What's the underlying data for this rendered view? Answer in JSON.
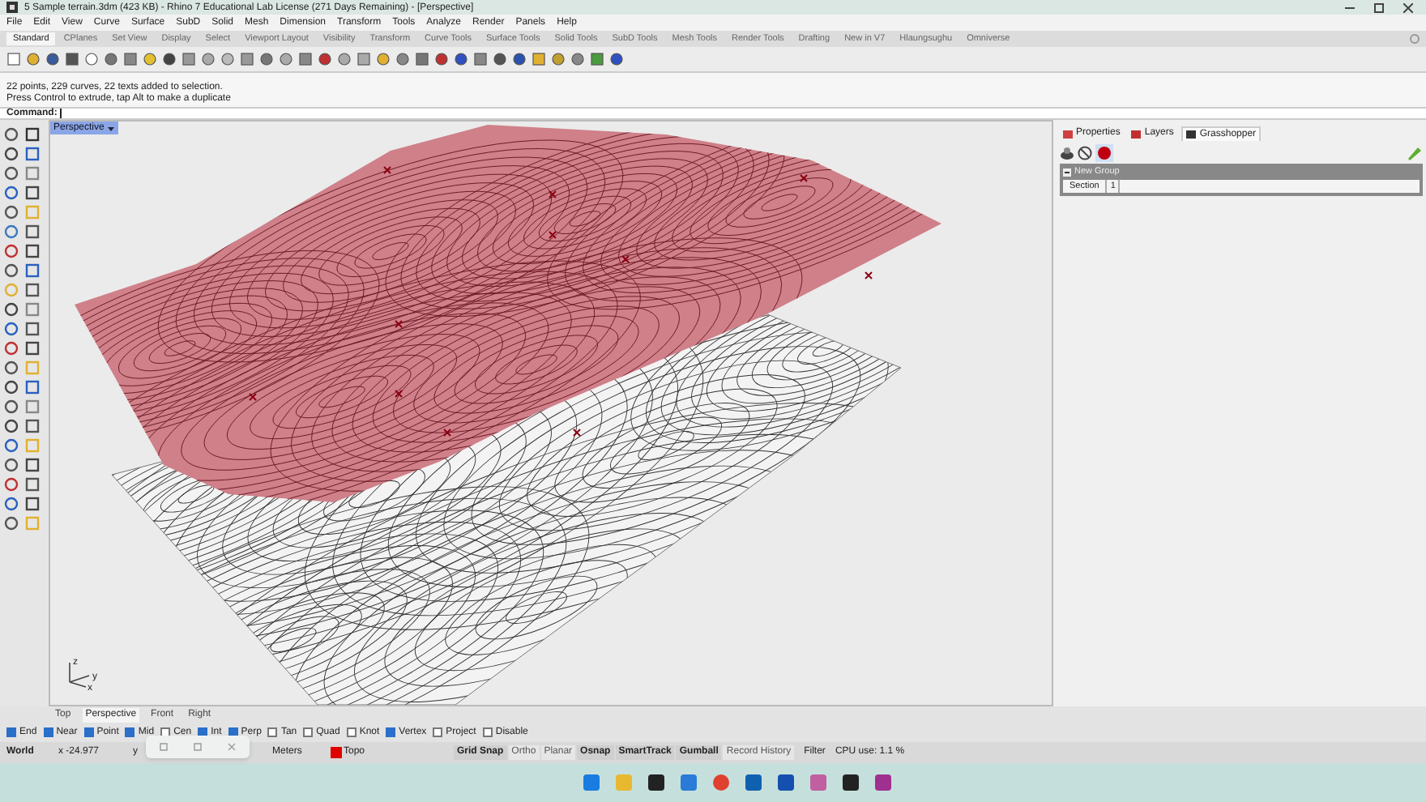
{
  "window": {
    "title": "5 Sample terrain.3dm (423 KB) - Rhino 7 Educational Lab License (271 Days Remaining) - [Perspective]"
  },
  "menu": [
    "File",
    "Edit",
    "View",
    "Curve",
    "Surface",
    "SubD",
    "Solid",
    "Mesh",
    "Dimension",
    "Transform",
    "Tools",
    "Analyze",
    "Render",
    "Panels",
    "Help"
  ],
  "toolbar_tabs": [
    {
      "label": "Standard",
      "selected": true
    },
    {
      "label": "CPlanes",
      "selected": false
    },
    {
      "label": "Set View",
      "selected": false
    },
    {
      "label": "Display",
      "selected": false
    },
    {
      "label": "Select",
      "selected": false
    },
    {
      "label": "Viewport Layout",
      "selected": false
    },
    {
      "label": "Visibility",
      "selected": false
    },
    {
      "label": "Transform",
      "selected": false
    },
    {
      "label": "Curve Tools",
      "selected": false
    },
    {
      "label": "Surface Tools",
      "selected": false
    },
    {
      "label": "Solid Tools",
      "selected": false
    },
    {
      "label": "SubD Tools",
      "selected": false
    },
    {
      "label": "Mesh Tools",
      "selected": false
    },
    {
      "label": "Render Tools",
      "selected": false
    },
    {
      "label": "Drafting",
      "selected": false
    },
    {
      "label": "New in V7",
      "selected": false
    },
    {
      "label": "Hlaungsughu",
      "selected": false
    },
    {
      "label": "Omniverse",
      "selected": false
    }
  ],
  "command_history": [
    "22 points, 229 curves, 22 texts added to selection.",
    "Press Control to extrude, tap Alt to make a duplicate"
  ],
  "command_prompt": "Command:",
  "viewport": {
    "label": "Perspective",
    "axes": [
      "z",
      "y",
      "x"
    ]
  },
  "panel": {
    "tabs": [
      {
        "label": "Properties",
        "selected": false
      },
      {
        "label": "Layers",
        "selected": false
      },
      {
        "label": "Grasshopper",
        "selected": true
      }
    ],
    "group": "New Group",
    "field_label": "Section",
    "field_value": "1"
  },
  "viewport_tabs": [
    {
      "label": "Top",
      "selected": false
    },
    {
      "label": "Perspective",
      "selected": true
    },
    {
      "label": "Front",
      "selected": false
    },
    {
      "label": "Right",
      "selected": false
    }
  ],
  "osnaps": [
    {
      "label": "End",
      "checked": true
    },
    {
      "label": "Near",
      "checked": true
    },
    {
      "label": "Point",
      "checked": true
    },
    {
      "label": "Mid",
      "checked": true
    },
    {
      "label": "Cen",
      "checked": false
    },
    {
      "label": "Int",
      "checked": true
    },
    {
      "label": "Perp",
      "checked": true
    },
    {
      "label": "Tan",
      "checked": false
    },
    {
      "label": "Quad",
      "checked": false
    },
    {
      "label": "Knot",
      "checked": false
    },
    {
      "label": "Vertex",
      "checked": true
    },
    {
      "label": "Project",
      "checked": false
    },
    {
      "label": "Disable",
      "checked": false
    }
  ],
  "status_bar": {
    "cplane": "World",
    "x": "x -24.977",
    "y": "y",
    "units": "Meters",
    "layer": {
      "label": "Topo",
      "color": "#e00000"
    },
    "toggles": [
      {
        "label": "Grid Snap",
        "on": true
      },
      {
        "label": "Ortho",
        "on": false
      },
      {
        "label": "Planar",
        "on": false
      },
      {
        "label": "Osnap",
        "on": true
      },
      {
        "label": "SmartTrack",
        "on": true
      },
      {
        "label": "Gumball",
        "on": true
      },
      {
        "label": "Record History",
        "on": false
      }
    ],
    "filter": "Filter",
    "cpu": "CPU use: 1.1 %"
  }
}
